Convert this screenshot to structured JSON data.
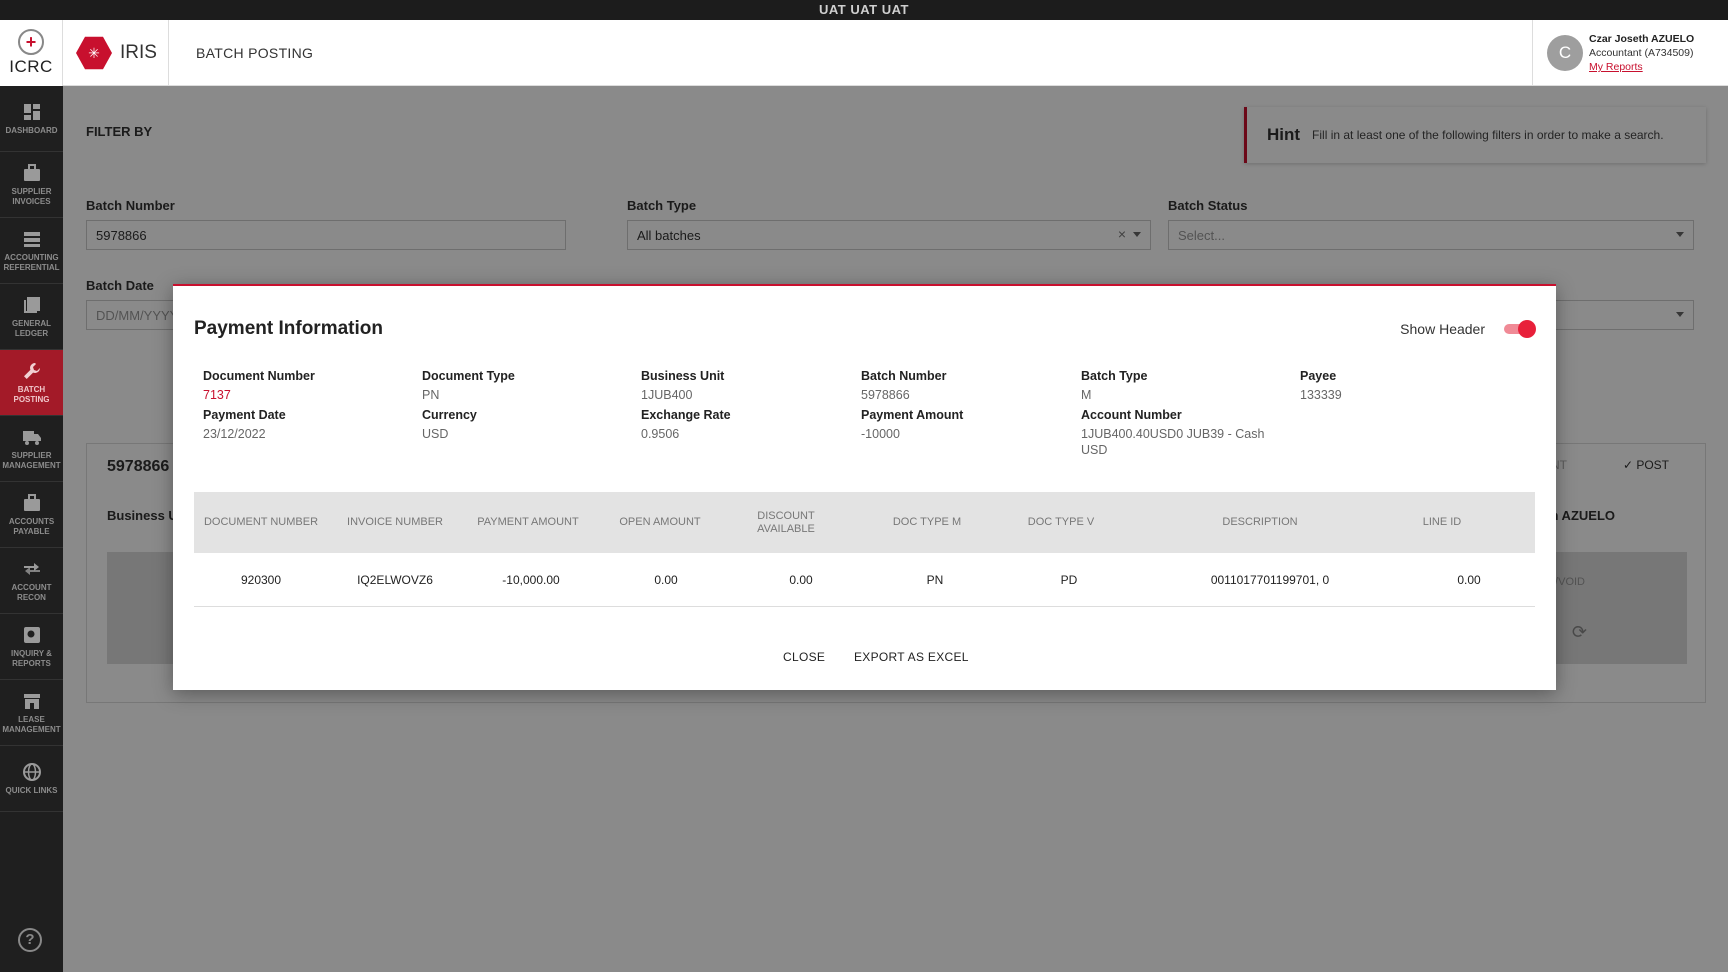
{
  "env_banner": "UAT UAT UAT",
  "sidebar": {
    "logo_text": "ICRC",
    "items": [
      {
        "label": "DASHBOARD",
        "icon": "dashboard-icon"
      },
      {
        "label": "SUPPLIER INVOICES",
        "icon": "briefcase-icon"
      },
      {
        "label": "ACCOUNTING REFERENTIAL",
        "icon": "stack-icon"
      },
      {
        "label": "GENERAL LEDGER",
        "icon": "book-icon"
      },
      {
        "label": "BATCH POSTING",
        "icon": "wrench-icon",
        "active": true
      },
      {
        "label": "SUPPLIER MANAGEMENT",
        "icon": "truck-icon"
      },
      {
        "label": "ACCOUNTS PAYABLE",
        "icon": "case-icon"
      },
      {
        "label": "ACCOUNT RECON",
        "icon": "arrows-icon"
      },
      {
        "label": "INQUIRY & REPORTS",
        "icon": "search-icon"
      },
      {
        "label": "LEASE MANAGEMENT",
        "icon": "store-icon"
      },
      {
        "label": "QUICK LINKS",
        "icon": "globe-icon"
      }
    ],
    "help": "?"
  },
  "topbar": {
    "app_name": "IRIS",
    "page_title": "BATCH POSTING",
    "user": {
      "initial": "C",
      "name": "Czar Joseth AZUELO",
      "role": "Accountant (A734509)",
      "link": "My Reports"
    }
  },
  "filter": {
    "title": "FILTER BY",
    "hint_title": "Hint",
    "hint_text": "Fill in at least one of the following filters in order to make a search.",
    "batch_number_label": "Batch Number",
    "batch_number_value": "5978866",
    "batch_type_label": "Batch Type",
    "batch_type_value": "All batches",
    "batch_status_label": "Batch Status",
    "batch_status_placeholder": "Select...",
    "batch_date_label": "Batch Date",
    "batch_date_placeholder": "DD/MM/YYYY"
  },
  "batch_card": {
    "number": "5978866",
    "business_unit_label": "Business Ur",
    "action_print": "INT",
    "action_post": "POST",
    "right_name": "h AZUELO",
    "void_label": "/VOID"
  },
  "modal": {
    "title": "Payment Information",
    "show_header_label": "Show Header",
    "show_header_on": true,
    "fields": [
      {
        "label": "Document Number",
        "value": "7137",
        "highlight": true
      },
      {
        "label": "Document Type",
        "value": "PN"
      },
      {
        "label": "Business Unit",
        "value": "1JUB400"
      },
      {
        "label": "Batch Number",
        "value": "5978866"
      },
      {
        "label": "Batch Type",
        "value": "M"
      },
      {
        "label": "Payee",
        "value": "133339"
      },
      {
        "label": "Payment Date",
        "value": "23/12/2022"
      },
      {
        "label": "Currency",
        "value": "USD"
      },
      {
        "label": "Exchange Rate",
        "value": "0.9506"
      },
      {
        "label": "Payment Amount",
        "value": "-10000"
      },
      {
        "label": "Account Number",
        "value": "1JUB400.40USD0 JUB39 - Cash USD"
      }
    ],
    "table": {
      "columns": [
        "DOCUMENT NUMBER",
        "INVOICE NUMBER",
        "PAYMENT AMOUNT",
        "OPEN AMOUNT",
        "DISCOUNT AVAILABLE",
        "DOC TYPE M",
        "DOC TYPE V",
        "DESCRIPTION",
        "LINE ID"
      ],
      "rows": [
        [
          "920300",
          "IQ2ELWOVZ6",
          "-10,000.00",
          "0.00",
          "0.00",
          "PN",
          "PD",
          "0011017701199701, 0",
          "0.00"
        ]
      ]
    },
    "close_label": "CLOSE",
    "export_label": "EXPORT AS EXCEL"
  }
}
